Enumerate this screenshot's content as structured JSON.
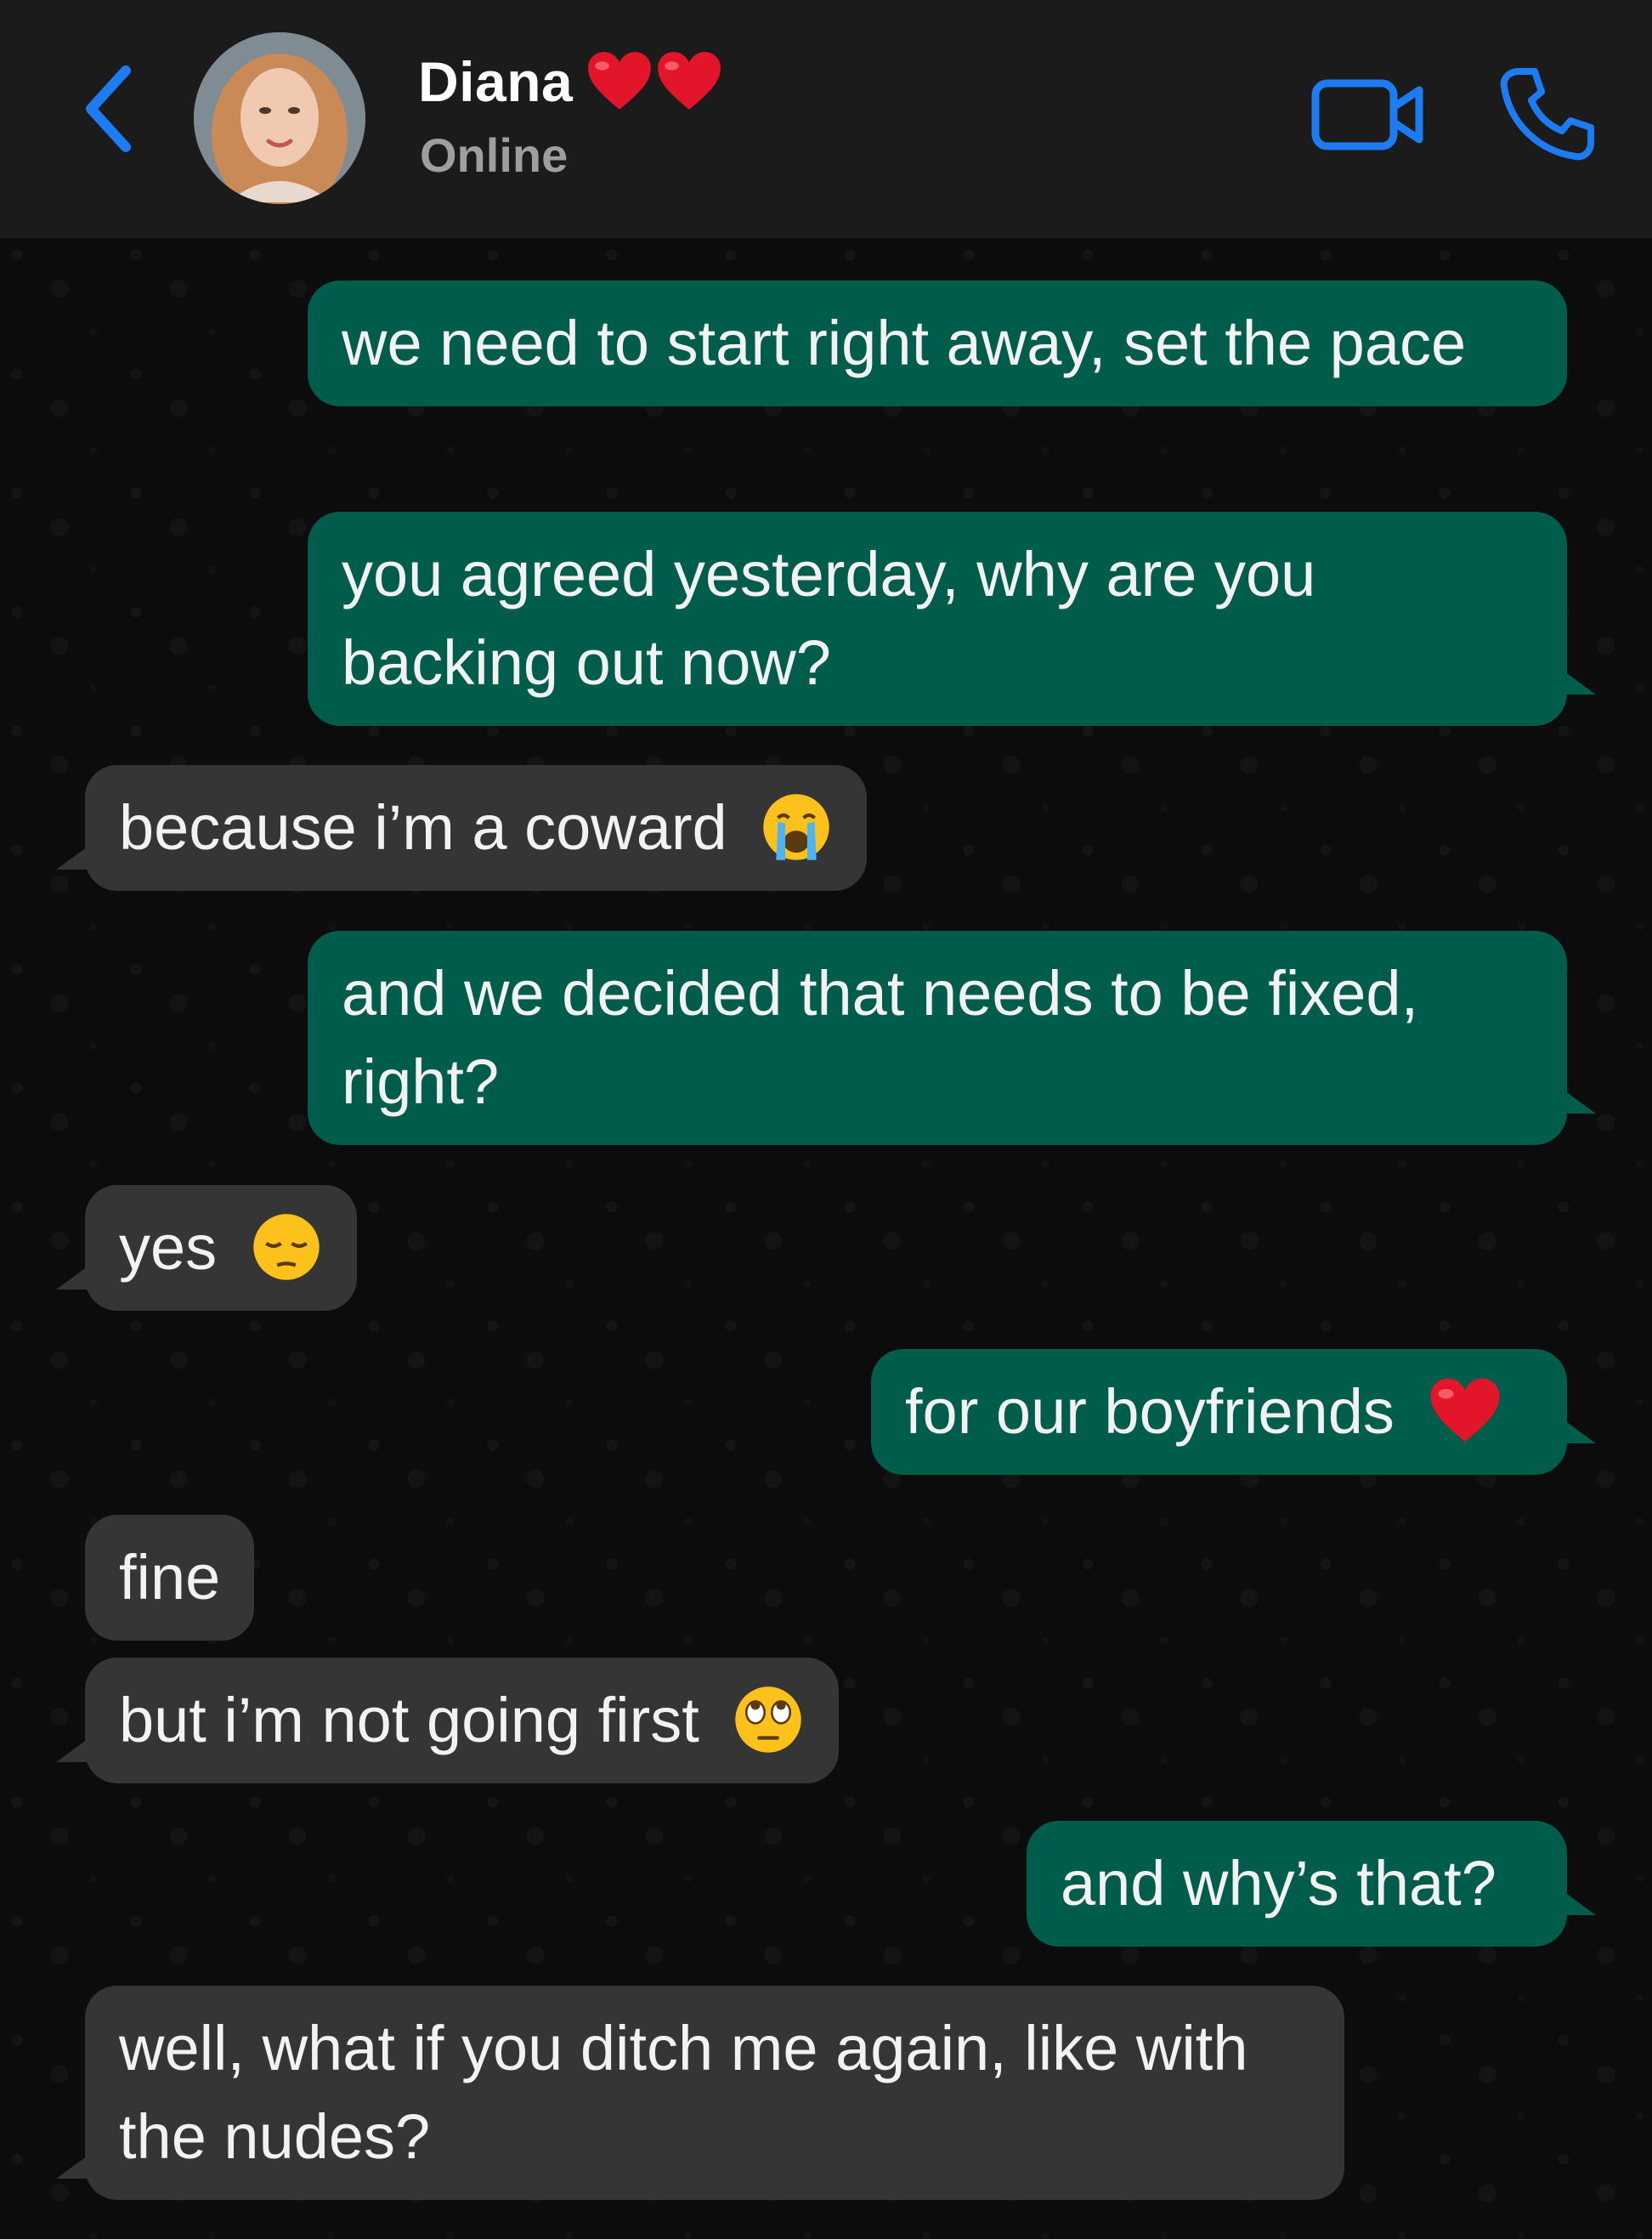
{
  "header": {
    "contact_name": "Diana",
    "name_emoji": "❤️❤️",
    "status": "Online",
    "back_icon": "chevron-left-icon",
    "video_icon": "video-camera-icon",
    "call_icon": "phone-icon",
    "accent_color": "#1e7cf2"
  },
  "messages": [
    {
      "direction": "outgoing",
      "text": "we need to start right away, set the pace"
    },
    {
      "direction": "outgoing",
      "text": "you agreed yesterday, why are you backing out now?"
    },
    {
      "direction": "incoming",
      "text": "because i’m a coward",
      "emoji": "loudly-crying-face-icon"
    },
    {
      "direction": "outgoing",
      "text": "and we decided that needs to be fixed, right?"
    },
    {
      "direction": "incoming",
      "text": "yes",
      "emoji": "pensive-face-icon"
    },
    {
      "direction": "outgoing",
      "text": "for our boyfriends",
      "emoji": "red-heart-icon"
    },
    {
      "direction": "incoming",
      "text": "fine"
    },
    {
      "direction": "incoming",
      "text": "but i’m not going first",
      "emoji": "face-with-rolling-eyes-icon"
    },
    {
      "direction": "outgoing",
      "text": "and why’s that?"
    },
    {
      "direction": "incoming",
      "text": "well, what if you ditch me again, like with the nudes?"
    }
  ],
  "colors": {
    "outgoing_bubble": "#005c4b",
    "incoming_bubble": "#353535",
    "header_bg": "#1b1b1b",
    "chat_bg": "#0c0c0c"
  }
}
